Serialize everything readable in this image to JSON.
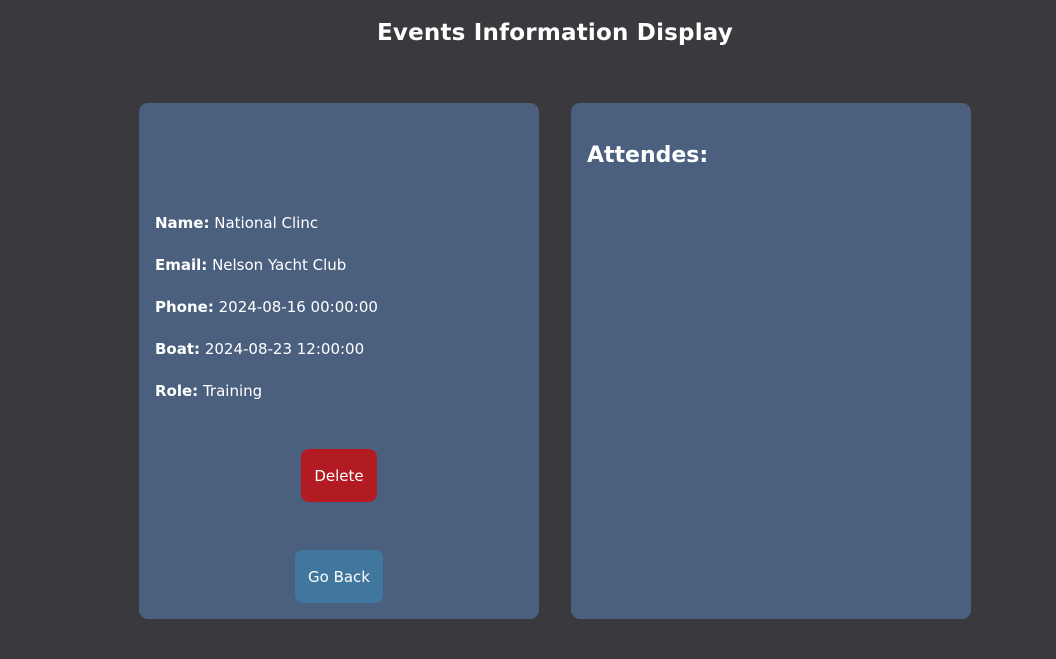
{
  "page": {
    "title": "Events Information Display"
  },
  "details": {
    "name_label": "Name:",
    "name_value": "National Clinc",
    "email_label": "Email:",
    "email_value": "Nelson Yacht Club",
    "phone_label": "Phone:",
    "phone_value": "2024-08-16 00:00:00",
    "boat_label": "Boat:",
    "boat_value": "2024-08-23 12:00:00",
    "role_label": "Role:",
    "role_value": "Training"
  },
  "actions": {
    "delete_label": "Delete",
    "back_label": "Go Back"
  },
  "attendees": {
    "heading": "Attendes:",
    "items": []
  },
  "colors": {
    "background": "#3a393d",
    "card": "#4a607e",
    "delete": "#b31b22",
    "back": "#41769e"
  }
}
